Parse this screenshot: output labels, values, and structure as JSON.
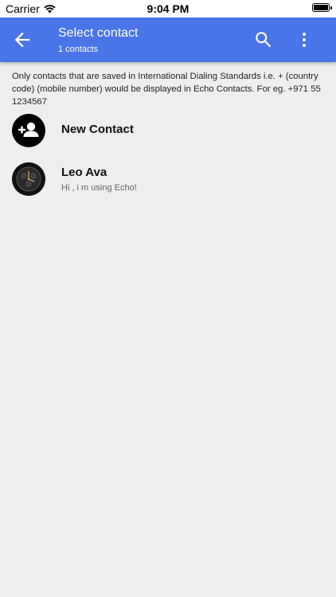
{
  "status_bar": {
    "carrier": "Carrier",
    "time": "9:04 PM"
  },
  "app_bar": {
    "title": "Select contact",
    "subtitle": "1 contacts",
    "color": "#4a75e8"
  },
  "notice": "Only contacts that are saved in International Dialing Standards i.e. + (country code) (mobile number) would be displayed in Echo Contacts. For eg. +971 55 1234567",
  "new_contact": {
    "label": "New Contact",
    "icon": "add-person-icon"
  },
  "contacts": [
    {
      "name": "Leo Ava",
      "status": "Hi , i m using Echo!",
      "avatar": "watch-face-avatar"
    }
  ]
}
